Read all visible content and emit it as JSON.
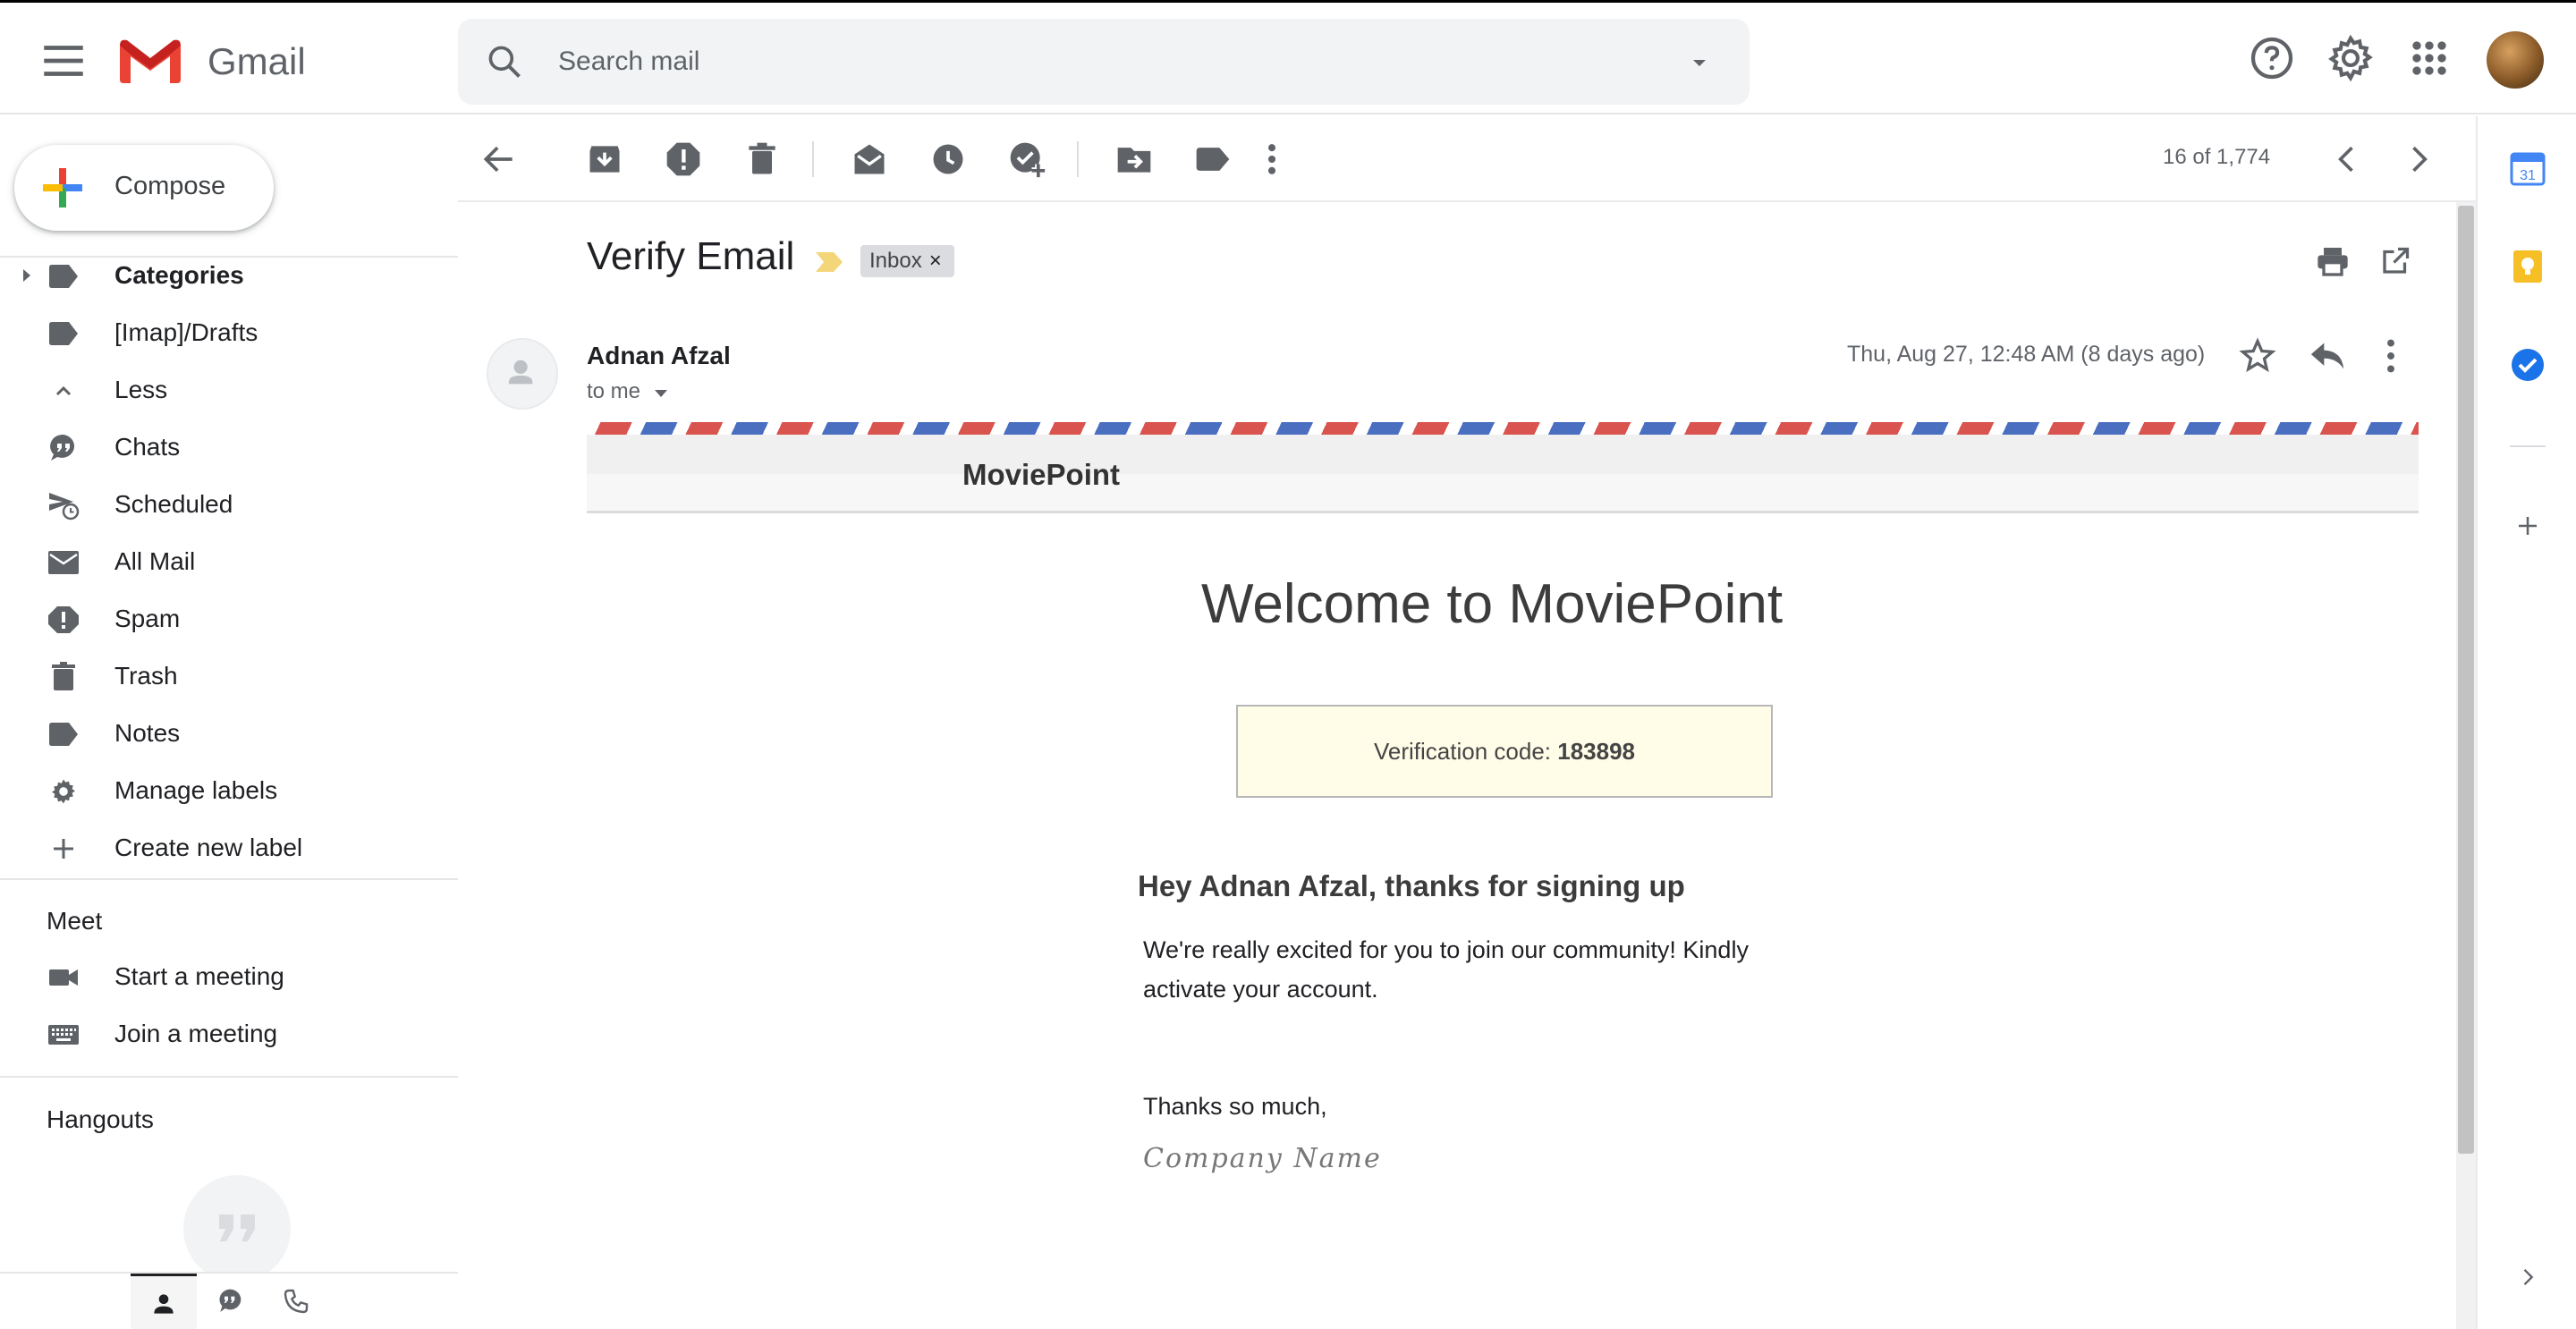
{
  "app": {
    "name": "Gmail",
    "avatar": "user-avatar"
  },
  "search": {
    "placeholder": "Search mail"
  },
  "compose": {
    "label": "Compose"
  },
  "nav": {
    "items": [
      {
        "label": "Categories",
        "icon": "label-icon",
        "bold": true
      },
      {
        "label": "[Imap]/Drafts",
        "icon": "label-icon"
      },
      {
        "label": "Less",
        "icon": "chevron-up-icon"
      },
      {
        "label": "Chats",
        "icon": "chat-icon"
      },
      {
        "label": "Scheduled",
        "icon": "scheduled-send-icon"
      },
      {
        "label": "All Mail",
        "icon": "mail-icon"
      },
      {
        "label": "Spam",
        "icon": "spam-icon"
      },
      {
        "label": "Trash",
        "icon": "trash-icon"
      },
      {
        "label": "Notes",
        "icon": "label-icon"
      },
      {
        "label": "Manage labels",
        "icon": "gear-icon"
      },
      {
        "label": "Create new label",
        "icon": "plus-icon"
      }
    ],
    "meet": {
      "heading": "Meet",
      "start": "Start a meeting",
      "join": "Join a meeting"
    },
    "hangouts": {
      "heading": "Hangouts"
    }
  },
  "toolbar": {
    "pager": "16 of 1,774"
  },
  "message": {
    "subject": "Verify Email",
    "label_chip": "Inbox",
    "label_chip_close": "×",
    "sender": "Adnan Afzal",
    "recipient": "to me",
    "date": "Thu, Aug 27, 12:48 AM (8 days ago)"
  },
  "email_body": {
    "brand": "MoviePoint",
    "welcome": "Welcome to MoviePoint",
    "code_label": "Verification code: ",
    "code_value": "183898",
    "greeting": "Hey Adnan Afzal, thanks for signing up",
    "paragraph": "We're really excited for you to join our community! Kindly activate your account.",
    "thanks": "Thanks so much,",
    "signature": "Company Name"
  },
  "side_panel": {
    "calendar_day": "31"
  },
  "colors": {
    "gmail_red": "#ea4335",
    "importance_yellow": "#f4d67a",
    "airmail_red": "#d9534f",
    "airmail_blue": "#4a6fc1",
    "code_box_bg": "#fffde8",
    "keep_yellow": "#f6bf26",
    "tasks_blue": "#1a73e8"
  }
}
